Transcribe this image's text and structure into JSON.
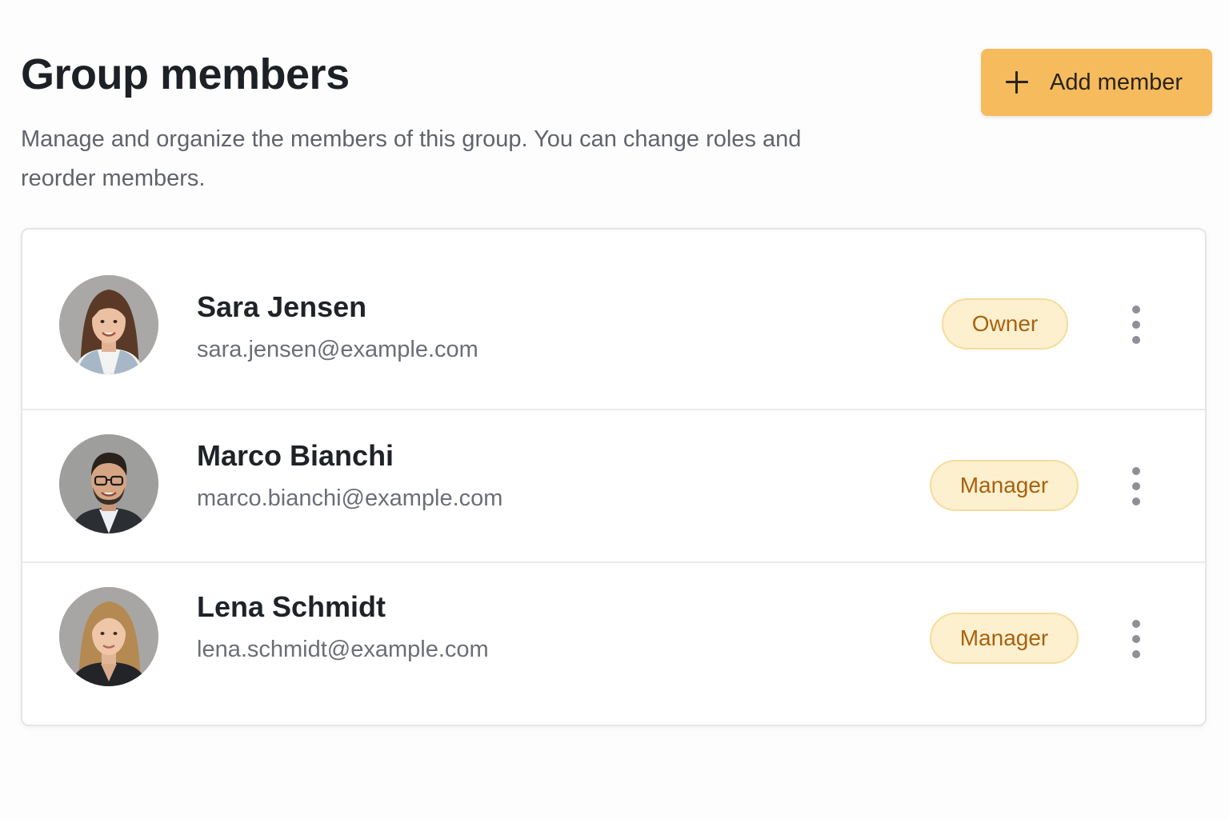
{
  "header": {
    "title": "Group members",
    "description": "Manage and organize the members of this group. You can change roles and reorder members."
  },
  "actions": {
    "add_member_label": "Add member",
    "add_member_icon": "plus-icon",
    "accent_color": "#f5bb5c"
  },
  "members": [
    {
      "name": "Sara Jensen",
      "email": "sara.jensen@example.com",
      "role": "Owner",
      "menu_icon": "more-vertical-icon"
    },
    {
      "name": "Marco Bianchi",
      "email": "marco.bianchi@example.com",
      "role": "Manager",
      "menu_icon": "more-vertical-icon"
    },
    {
      "name": "Lena Schmidt",
      "email": "lena.schmidt@example.com",
      "role": "Manager",
      "menu_icon": "more-vertical-icon"
    }
  ],
  "colors": {
    "badge_background": "#fdf0cf",
    "badge_border": "#f6dc9c",
    "badge_text": "#a8620f"
  }
}
